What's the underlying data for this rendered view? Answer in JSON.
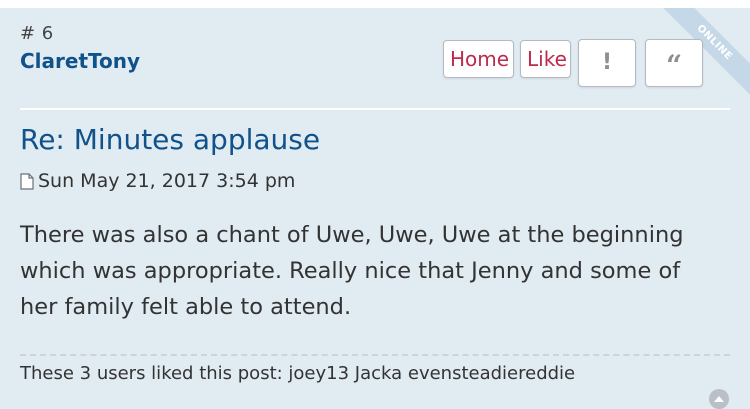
{
  "post": {
    "number": "# 6",
    "author": "ClaretTony",
    "status_ribbon": "ONLINE",
    "title": "Re: Minutes applause",
    "date": "Sun May 21, 2017 3:54 pm",
    "content": "There was also a chant of Uwe, Uwe, Uwe at the beginning which was appropriate. Really nice that Jenny and some of her family felt able to attend.",
    "likes_text": "These 3 users liked this post: joey13 Jacka evensteadiereddie"
  },
  "buttons": {
    "home": "Home",
    "like": "Like",
    "report_icon": "!",
    "quote_icon": "“"
  },
  "icons": {
    "post": "post-page-icon",
    "report": "exclamation-icon",
    "quote": "quote-icon",
    "top": "back-to-top-icon"
  },
  "colors": {
    "background": "#e1ebf2",
    "link": "#105289",
    "button_text": "#bc2a4d",
    "ribbon": "#c5d8e8"
  }
}
